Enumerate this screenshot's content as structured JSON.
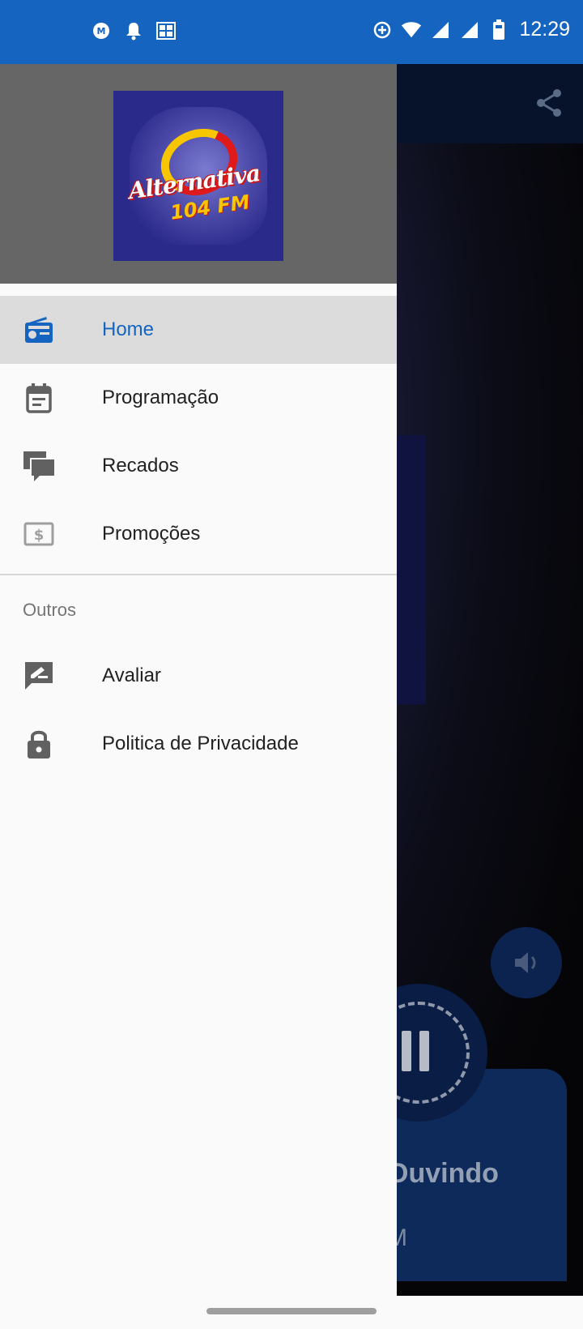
{
  "status_bar": {
    "time": "12:29",
    "left_icons": [
      "mercado-icon",
      "notification-bell-icon",
      "gallery-icon"
    ],
    "right_icons": [
      "data-saver-icon",
      "wifi-icon",
      "signal-icon",
      "signal-icon-2",
      "battery-icon"
    ],
    "color": "#1565c0"
  },
  "drawer": {
    "logo": {
      "text": "Alternativa",
      "frequency": "104 FM"
    },
    "menu_items": [
      {
        "label": "Home",
        "icon": "radio-icon",
        "active": true
      },
      {
        "label": "Programação",
        "icon": "calendar-icon",
        "active": false
      },
      {
        "label": "Recados",
        "icon": "chat-icon",
        "active": false
      },
      {
        "label": "Promoções",
        "icon": "money-icon",
        "active": false
      }
    ],
    "section_title": "Outros",
    "other_items": [
      {
        "label": "Avaliar",
        "icon": "rate-review-icon"
      },
      {
        "label": "Politica de Privacidade",
        "icon": "lock-icon"
      }
    ]
  },
  "background_app": {
    "now_playing_title": "Ouvindo",
    "now_playing_sub": "M"
  },
  "colors": {
    "accent": "#1565c0",
    "header_gray": "#666666",
    "active_bg": "#dcdcdc"
  }
}
